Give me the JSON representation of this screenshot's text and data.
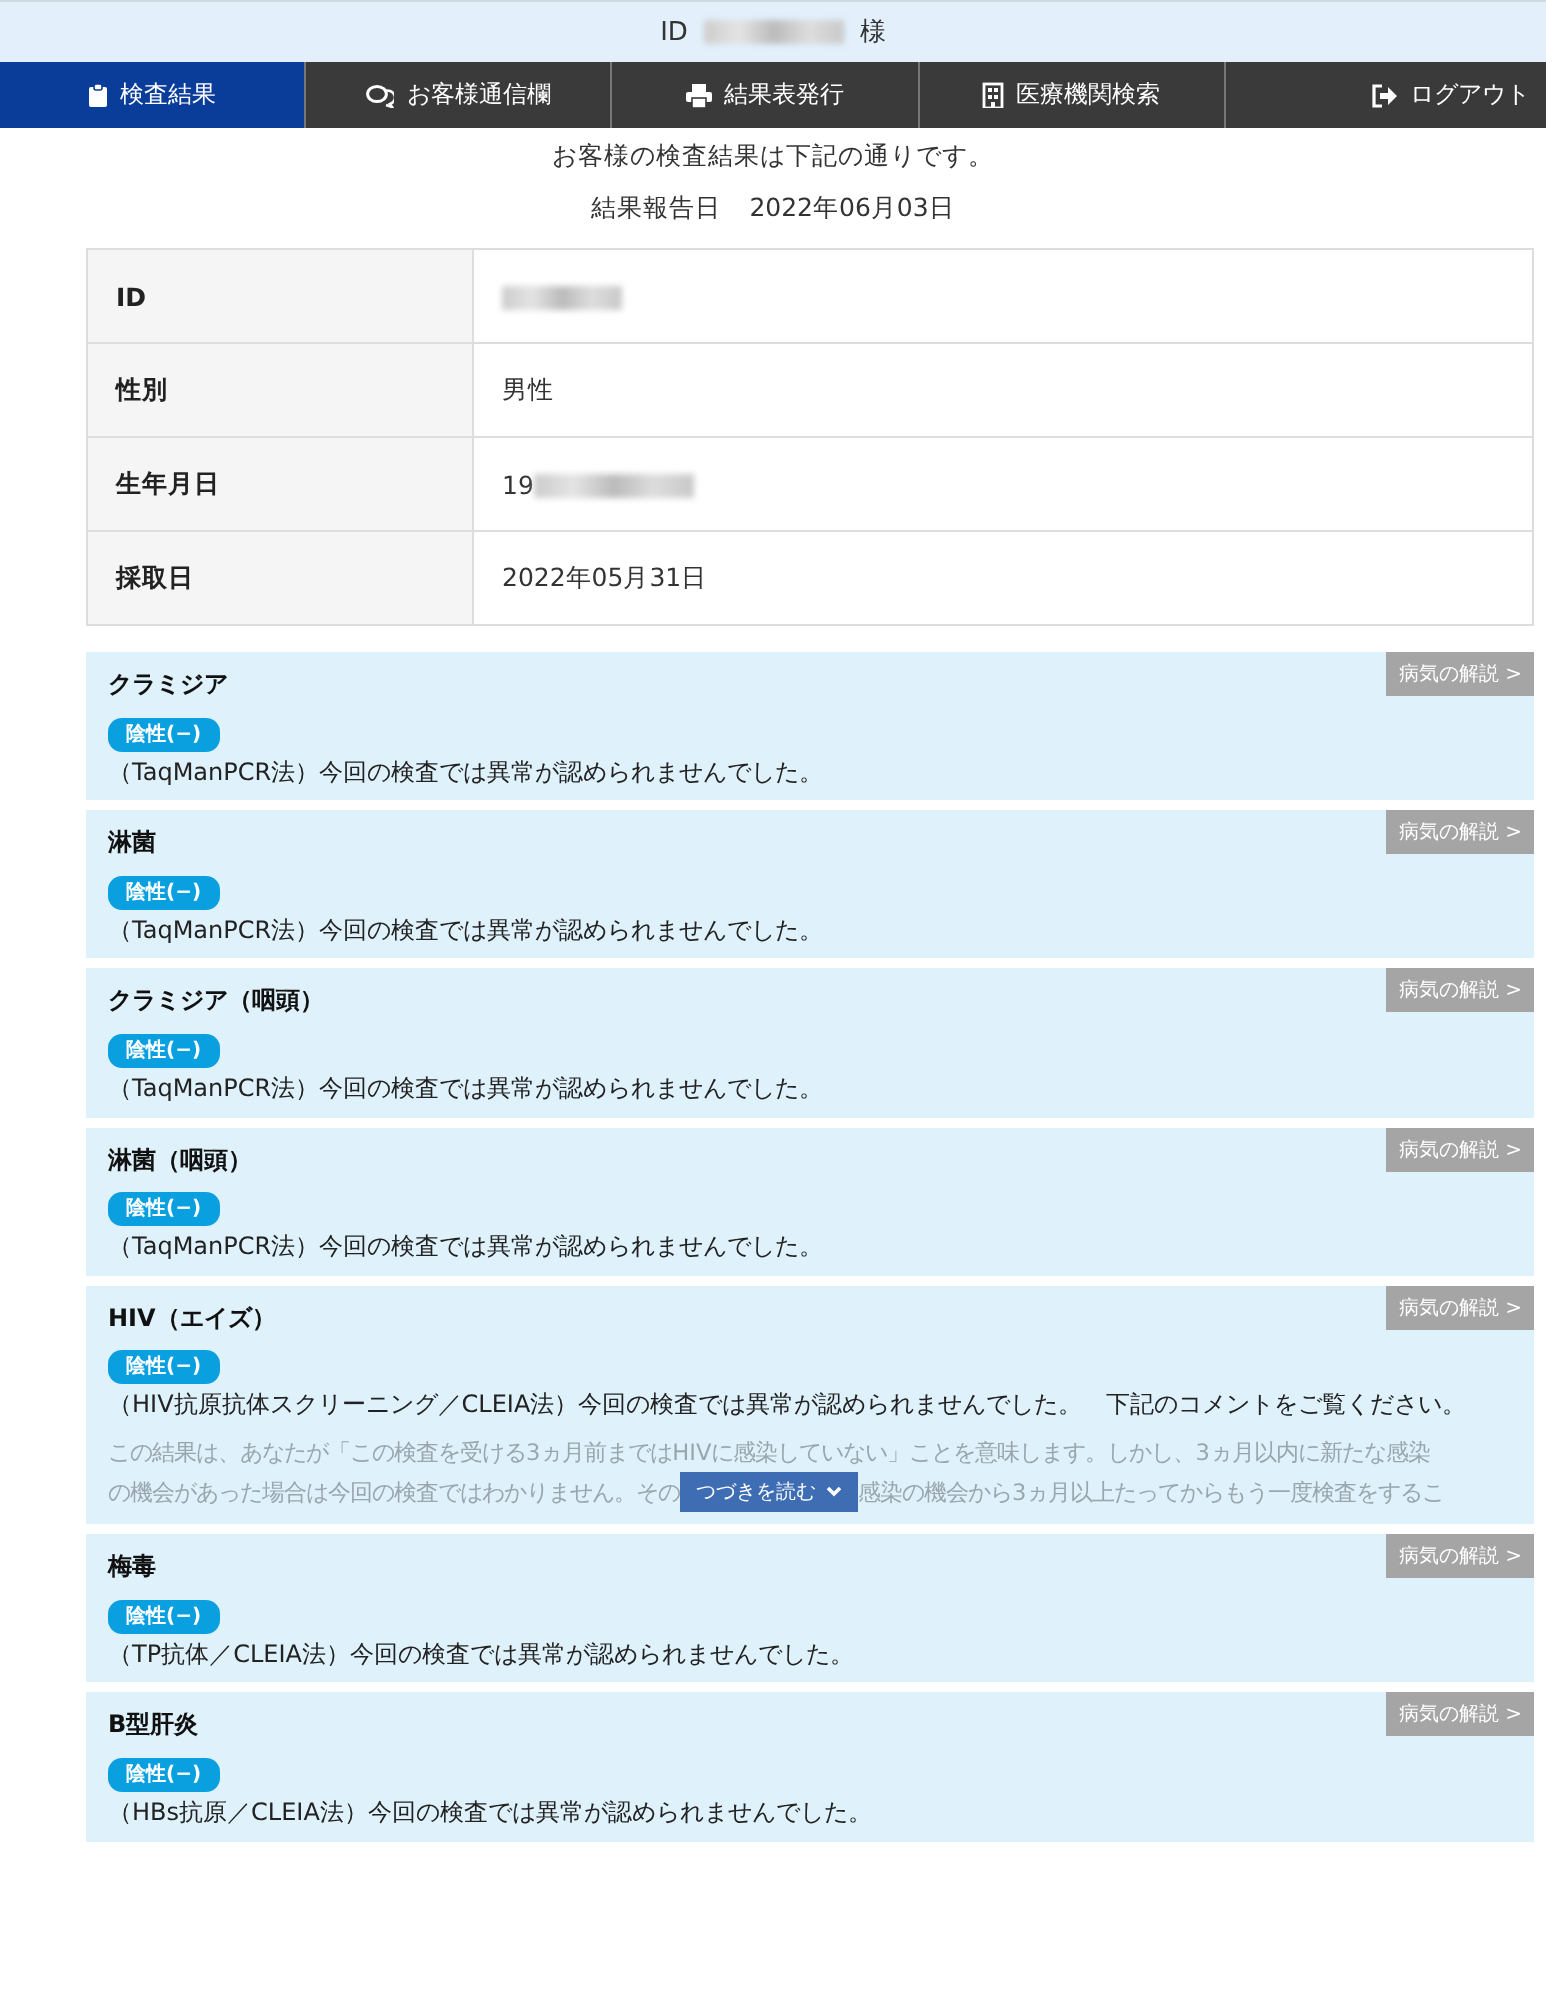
{
  "header": {
    "id_label": "ID",
    "id_redacted": true,
    "suffix": "様"
  },
  "tabs": [
    {
      "label": "検査結果",
      "selected": true
    },
    {
      "label": "お客様通信欄",
      "selected": false
    },
    {
      "label": "結果表発行",
      "selected": false
    },
    {
      "label": "医療機関検索",
      "selected": false
    },
    {
      "label": "ログアウト",
      "selected": false
    }
  ],
  "intro": "お客様の検査結果は下記の通りです。",
  "report_date": {
    "label": "結果報告日",
    "value": "2022年06月03日"
  },
  "profile": [
    {
      "label": "ID",
      "redacted": true
    },
    {
      "label": "性別",
      "value": "男性",
      "redacted": false
    },
    {
      "label": "生年月日",
      "value": "19",
      "redacted": true
    },
    {
      "label": "採取日",
      "value": "2022年05月31日",
      "redacted": false
    }
  ],
  "results": [
    {
      "name": "クラミジア",
      "badge": "陰性(−)",
      "text": "（TaqManPCR法）今回の検査では異常が認められませんでした。",
      "link": "病気の解説 >"
    },
    {
      "name": "淋菌",
      "badge": "陰性(−)",
      "text": "（TaqManPCR法）今回の検査では異常が認められませんでした。",
      "link": "病気の解説 >"
    },
    {
      "name": "クラミジア（咽頭）",
      "badge": "陰性(−)",
      "text": "（TaqManPCR法）今回の検査では異常が認められませんでした。",
      "link": "病気の解説 >"
    },
    {
      "name": "淋菌（咽頭）",
      "badge": "陰性(−)",
      "text": "（TaqManPCR法）今回の検査では異常が認められませんでした。",
      "link": "病気の解説 >"
    },
    {
      "name": "HIV（エイズ）",
      "badge": "陰性(−)",
      "text": "（HIV抗原抗体スクリーニング／CLEIA法）今回の検査では異常が認められませんでした。　下記のコメントをご覧ください。",
      "link": "病気の解説 >",
      "comment": {
        "line_1": "この結果は、あなたが「この検査を受ける3ヵ月前まではHIVに感染していない」ことを意味します。しかし、3ヵ月以内に新たな感染",
        "line_2_start": "の機会があった場合は今回の検査ではわかりません。その",
        "line_2_end": "感染の機会から3ヵ月以上たってからもう一度検査をするこ",
        "more_button": "つづきを読む"
      }
    },
    {
      "name": "梅毒",
      "badge": "陰性(−)",
      "text": "（TP抗体／CLEIA法）今回の検査では異常が認められませんでした。",
      "link": "病気の解説 >"
    },
    {
      "name": "B型肝炎",
      "badge": "陰性(−)",
      "text": "（HBs抗原／CLEIA法）今回の検査では異常が認められませんでした。",
      "link": "病気の解説 >"
    }
  ]
}
